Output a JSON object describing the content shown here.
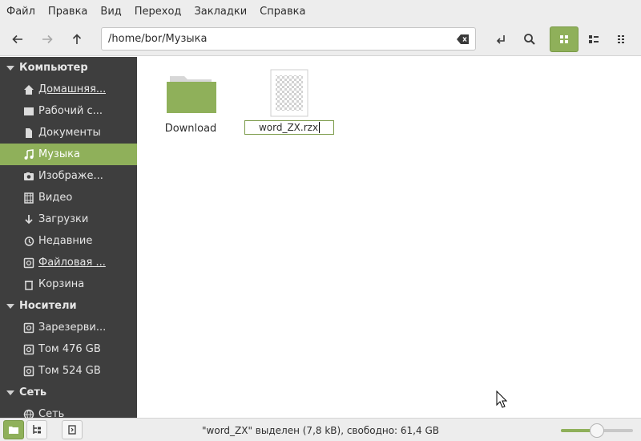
{
  "menu": [
    "Файл",
    "Правка",
    "Вид",
    "Переход",
    "Закладки",
    "Справка"
  ],
  "toolbar": {
    "path": "/home/bor/Музыка",
    "buttons": [
      "back-icon",
      "forward-icon",
      "up-icon",
      "toggle-location-icon",
      "search-icon",
      "icon-view-icon",
      "list-view-icon",
      "compact-view-icon"
    ]
  },
  "sidebar": {
    "computer_header": "Компьютер",
    "computer_items": [
      {
        "label": "Домашняя...",
        "icon": "home-icon"
      },
      {
        "label": "Рабочий с...",
        "icon": "desktop-icon"
      },
      {
        "label": "Документы",
        "icon": "documents-icon"
      },
      {
        "label": "Музыка",
        "icon": "music-icon"
      },
      {
        "label": "Изображе...",
        "icon": "pictures-icon"
      },
      {
        "label": "Видео",
        "icon": "video-icon"
      },
      {
        "label": "Загрузки",
        "icon": "downloads-icon"
      },
      {
        "label": "Недавние",
        "icon": "recent-icon"
      },
      {
        "label": "Файловая ...",
        "icon": "filesystem-icon"
      },
      {
        "label": "Корзина",
        "icon": "trash-icon"
      }
    ],
    "devices_header": "Носители",
    "devices_items": [
      {
        "label": "Зарезерви...",
        "icon": "drive-icon"
      },
      {
        "label": "Том 476 GB",
        "icon": "drive-icon"
      },
      {
        "label": "Том 524 GB",
        "icon": "drive-icon"
      }
    ],
    "network_header": "Сеть",
    "network_items": [
      {
        "label": "Сеть",
        "icon": "network-icon"
      }
    ]
  },
  "files": [
    {
      "name": "Download",
      "type": "folder"
    },
    {
      "name": "word_ZX.rzx",
      "type": "file",
      "renaming": true
    }
  ],
  "status": {
    "text": "\"word_ZX\" выделен (7,8 kB), свободно: 61,4 GB",
    "zoom_fraction": 0.5
  },
  "colors": {
    "accent": "#8fb05a",
    "sidebar_bg": "#3e3e3e",
    "folder": "#8fb05a"
  }
}
